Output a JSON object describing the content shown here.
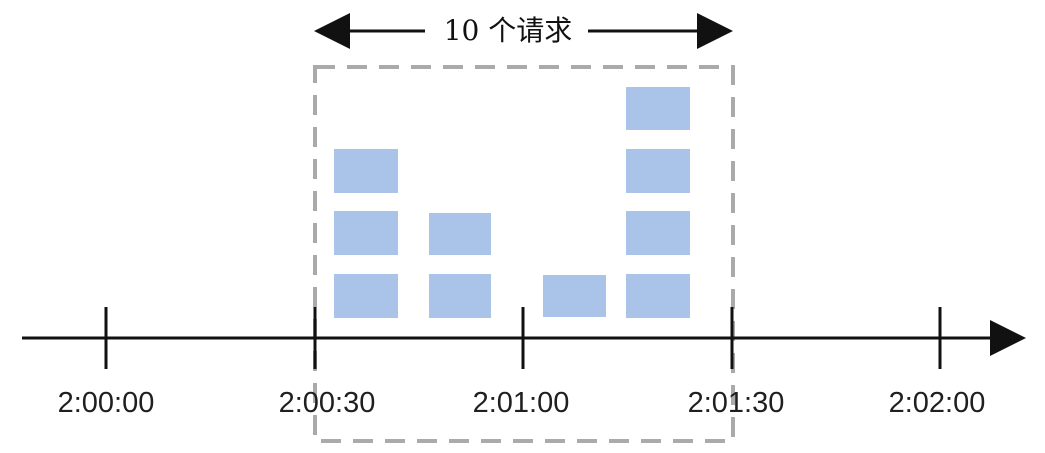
{
  "diagram": {
    "window_caption": "10 个请求",
    "time_axis": {
      "ticks": [
        {
          "label": "2:00:00"
        },
        {
          "label": "2:00:30"
        },
        {
          "label": "2:01:00"
        },
        {
          "label": "2:01:30"
        },
        {
          "label": "2:02:00"
        }
      ]
    },
    "colors": {
      "request_block": "#aac4e9",
      "window_border": "#aaaaaa",
      "axis": "#111111",
      "text": "#1f1f1f"
    },
    "request_blocks_count": 10
  }
}
